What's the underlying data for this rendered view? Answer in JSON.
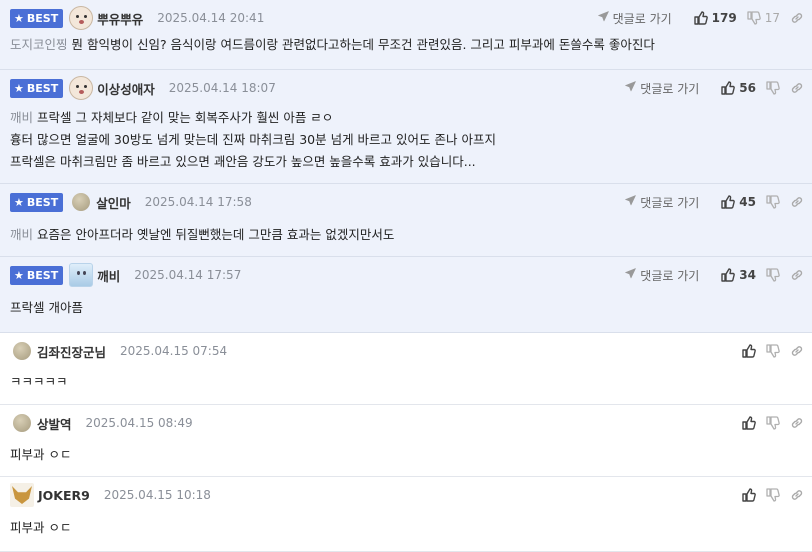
{
  "colors": {
    "best_badge": "#4a6fd6",
    "best_bg": "#eef2fb",
    "muted": "#8a8f98"
  },
  "comments": [
    {
      "best": true,
      "avatar": "dog-avatar",
      "nick": "뿌유뿌유",
      "date": "2025.04.14 20:41",
      "reply": "댓글로 가기",
      "up": "179",
      "down": "17",
      "prefix": "도지코인찡",
      "lines": [
        "뭔 함익병이 신임? 음식이랑 여드름이랑 관련없다고하는데 무조건 관련있음. 그리고 피부과에 돈쓸수록 좋아진다"
      ]
    },
    {
      "best": true,
      "avatar": "dog-avatar",
      "nick": "이상성애자",
      "date": "2025.04.14 18:07",
      "reply": "댓글로 가기",
      "up": "56",
      "down": "",
      "prefix": "깨비",
      "lines": [
        "프락셀 그 자체보다 같이 맞는 회복주사가 훨씬 아픔 ㄹㅇ",
        "흉터 많으면 얼굴에 30방도 넘게 맞는데 진짜 마취크림 30분 넘게 바르고 있어도 존나 아프지",
        "프락셀은 마취크림만 좀 바르고 있으면 괘안음 강도가 높으면 높을수록 효과가 있습니다..."
      ]
    },
    {
      "best": true,
      "avatar": "potato-avatar",
      "nick": "살인마",
      "date": "2025.04.14 17:58",
      "reply": "댓글로 가기",
      "up": "45",
      "down": "",
      "prefix": "깨비",
      "lines": [
        "요즘은 안아프더라 옛날엔 뒤질뻔했는데 그만큼 효과는 없겠지만서도"
      ]
    },
    {
      "best": true,
      "avatar": "ghost-avatar",
      "nick": "깨비",
      "date": "2025.04.14 17:57",
      "reply": "댓글로 가기",
      "up": "34",
      "down": "",
      "prefix": "",
      "lines": [
        "프락셀 개아픔"
      ]
    },
    {
      "best": false,
      "avatar": "potato-avatar",
      "nick": "김좌진장군님",
      "date": "2025.04.15 07:54",
      "reply": "",
      "up": "",
      "down": "",
      "prefix": "",
      "lines": [
        "ㅋㅋㅋㅋㅋ"
      ]
    },
    {
      "best": false,
      "avatar": "potato-avatar",
      "nick": "상발역",
      "date": "2025.04.15 08:49",
      "reply": "",
      "up": "",
      "down": "",
      "prefix": "",
      "lines": [
        "피부과 ㅇㄷ"
      ]
    },
    {
      "best": false,
      "avatar": "fox-avatar",
      "nick": "JOKER9",
      "date": "2025.04.15 10:18",
      "reply": "",
      "up": "",
      "down": "",
      "prefix": "",
      "lines": [
        "피부과 ㅇㄷ"
      ]
    }
  ],
  "badge": {
    "label": "BEST",
    "star": "★"
  },
  "icons": {
    "reply": "paper-plane-icon",
    "up": "thumbs-up-icon",
    "down": "thumbs-down-icon",
    "link": "link-icon"
  }
}
